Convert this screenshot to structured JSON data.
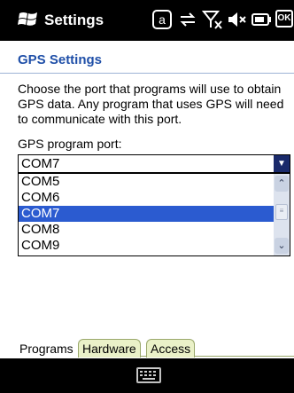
{
  "status_bar": {
    "title": "Settings",
    "icons": [
      "windows-logo-icon",
      "a-input-icon",
      "sync-icon",
      "signal-off-icon",
      "speaker-mute-icon",
      "battery-icon",
      "ok-button-icon"
    ],
    "ok_label": "OK",
    "a_label": "a"
  },
  "page": {
    "title": "GPS Settings",
    "description": "Choose the port that programs will use to obtain GPS data. Any program that uses GPS will need to communicate with this port.",
    "port_label": "GPS program port:"
  },
  "combo": {
    "value": "COM7",
    "options": [
      "COM5",
      "COM6",
      "COM7",
      "COM8",
      "COM9"
    ],
    "selected_index": 2
  },
  "tabs": [
    {
      "label": "Programs",
      "active": true
    },
    {
      "label": "Hardware",
      "active": false
    },
    {
      "label": "Access",
      "active": false
    }
  ],
  "softbar": {
    "icon": "keyboard-icon"
  },
  "colors": {
    "header_bg": "#000000",
    "title_blue": "#1f4fa8",
    "selection": "#2b5bd0",
    "tab_inactive": "#eaf1c8"
  }
}
